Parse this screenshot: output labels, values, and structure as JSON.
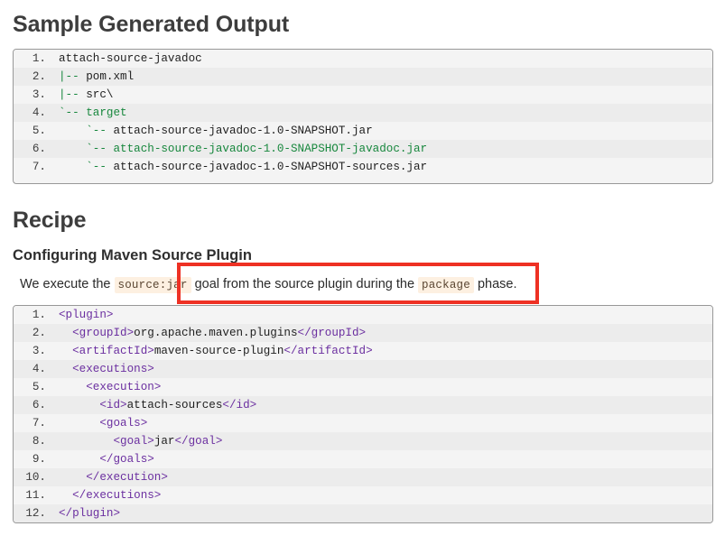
{
  "headings": {
    "sample_output": "Sample Generated Output",
    "recipe": "Recipe",
    "configuring": "Configuring Maven Source Plugin"
  },
  "paragraph": {
    "part1": "We execute the ",
    "code1": "source:jar",
    "part2": " goal from the source plugin during the ",
    "code2": "package",
    "part3": " phase."
  },
  "annotation": {
    "color": "#ee3124",
    "shape": "rectangle-outline",
    "target": "paragraph"
  },
  "colors": {
    "heading": "#3d3d3d",
    "code_green": "#17873d",
    "code_tag": "#6b2fa0",
    "inline_code_bg": "#fdf0e1",
    "block_border": "#989898",
    "row_odd": "#f4f4f4",
    "row_even": "#ececec"
  },
  "code_tree": {
    "lines": [
      {
        "n": "1.",
        "tokens": [
          {
            "t": "attach-source-javadoc",
            "c": "dark"
          }
        ]
      },
      {
        "n": "2.",
        "tokens": [
          {
            "t": "|-- ",
            "c": "green"
          },
          {
            "t": "pom.xml",
            "c": "dark"
          }
        ]
      },
      {
        "n": "3.",
        "tokens": [
          {
            "t": "|-- ",
            "c": "green"
          },
          {
            "t": "src\\",
            "c": "dark"
          }
        ]
      },
      {
        "n": "4.",
        "tokens": [
          {
            "t": "`-- ",
            "c": "green"
          },
          {
            "t": "target",
            "c": "green"
          }
        ]
      },
      {
        "n": "5.",
        "tokens": [
          {
            "t": "    `-- ",
            "c": "green"
          },
          {
            "t": "attach-source-javadoc-1.0-SNAPSHOT.jar",
            "c": "dark"
          }
        ]
      },
      {
        "n": "6.",
        "tokens": [
          {
            "t": "    `-- ",
            "c": "green"
          },
          {
            "t": "attach-source-javadoc-1.0-SNAPSHOT-javadoc.jar",
            "c": "green"
          }
        ]
      },
      {
        "n": "7.",
        "tokens": [
          {
            "t": "    `-- ",
            "c": "green"
          },
          {
            "t": "attach-source-javadoc-1.0-SNAPSHOT-sources.jar",
            "c": "dark"
          }
        ]
      }
    ]
  },
  "code_xml": {
    "lines": [
      {
        "n": "1.",
        "tokens": [
          {
            "t": "<plugin>",
            "c": "tag"
          }
        ]
      },
      {
        "n": "2.",
        "tokens": [
          {
            "t": "  <groupId>",
            "c": "tag"
          },
          {
            "t": "org.apache.maven.plugins",
            "c": "plain"
          },
          {
            "t": "</groupId>",
            "c": "tag"
          }
        ]
      },
      {
        "n": "3.",
        "tokens": [
          {
            "t": "  <artifactId>",
            "c": "tag"
          },
          {
            "t": "maven-source-plugin",
            "c": "plain"
          },
          {
            "t": "</artifactId>",
            "c": "tag"
          }
        ]
      },
      {
        "n": "4.",
        "tokens": [
          {
            "t": "  <executions>",
            "c": "tag"
          }
        ]
      },
      {
        "n": "5.",
        "tokens": [
          {
            "t": "    <execution>",
            "c": "tag"
          }
        ]
      },
      {
        "n": "6.",
        "tokens": [
          {
            "t": "      <id>",
            "c": "tag"
          },
          {
            "t": "attach-sources",
            "c": "plain"
          },
          {
            "t": "</id>",
            "c": "tag"
          }
        ]
      },
      {
        "n": "7.",
        "tokens": [
          {
            "t": "      <goals>",
            "c": "tag"
          }
        ]
      },
      {
        "n": "8.",
        "tokens": [
          {
            "t": "        <goal>",
            "c": "tag"
          },
          {
            "t": "jar",
            "c": "plain"
          },
          {
            "t": "</goal>",
            "c": "tag"
          }
        ]
      },
      {
        "n": "9.",
        "tokens": [
          {
            "t": "      </goals>",
            "c": "tag"
          }
        ]
      },
      {
        "n": "10.",
        "tokens": [
          {
            "t": "    </execution>",
            "c": "tag"
          }
        ]
      },
      {
        "n": "11.",
        "tokens": [
          {
            "t": "  </executions>",
            "c": "tag"
          }
        ]
      },
      {
        "n": "12.",
        "tokens": [
          {
            "t": "</plugin>",
            "c": "tag"
          }
        ]
      }
    ]
  }
}
